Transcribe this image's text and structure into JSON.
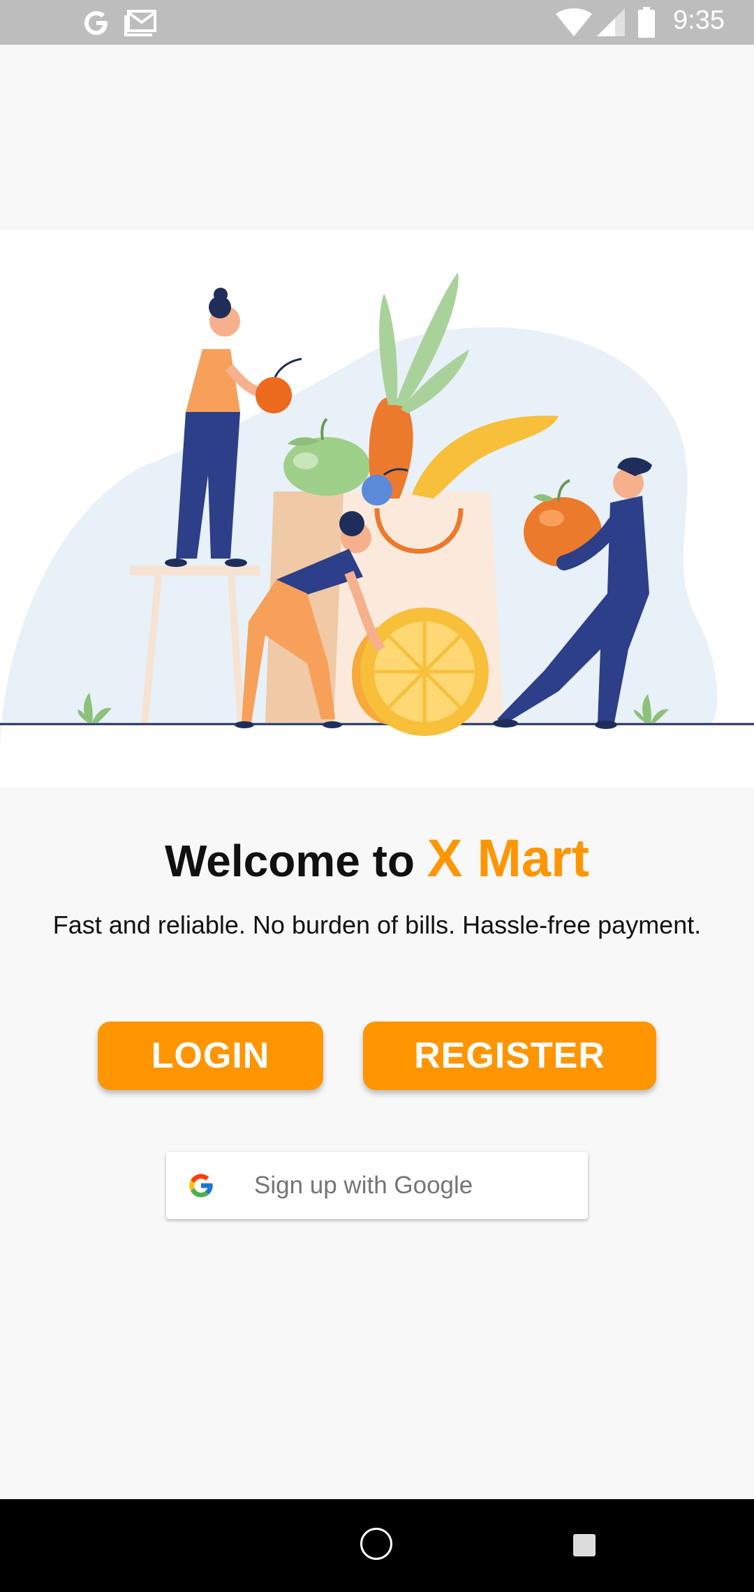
{
  "status_bar": {
    "time": "9:35",
    "icons": [
      "google-g-icon",
      "gmail-icon",
      "wifi-icon",
      "cell-signal-icon",
      "battery-icon"
    ]
  },
  "illustration": {
    "icon": "grocery-shopping-illustration"
  },
  "welcome": {
    "prefix": "Welcome to ",
    "brand": "X Mart",
    "tagline": "Fast and reliable. No burden of bills. Hassle-free payment."
  },
  "actions": {
    "login_label": "LOGIN",
    "register_label": "REGISTER",
    "google_label": "Sign up with Google"
  },
  "nav_bar": {
    "icons": [
      "home-icon",
      "recents-icon"
    ]
  },
  "colors": {
    "accent": "#ff9500",
    "status_bar": "#bdbdbd",
    "background": "#f8f8f8",
    "nav_bar": "#000000"
  }
}
